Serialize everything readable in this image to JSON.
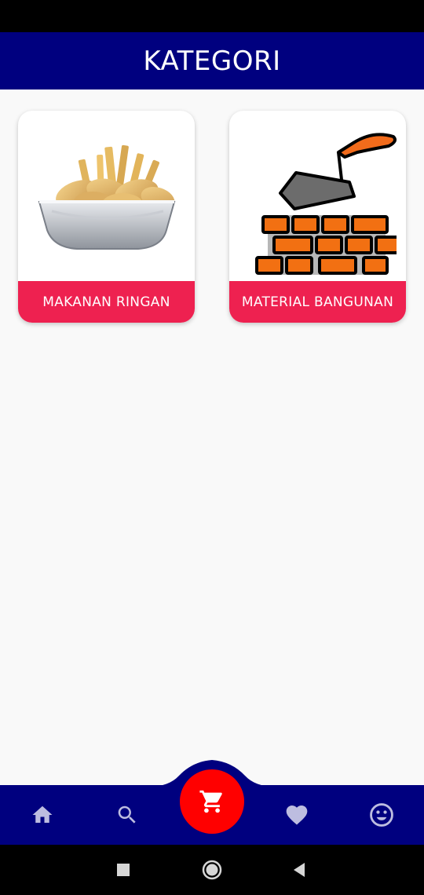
{
  "app_bar": {
    "title": "KATEGORI"
  },
  "categories": [
    {
      "label": "MAKANAN RINGAN",
      "icon": "snack-bowl-icon"
    },
    {
      "label": "MATERIAL BANGUNAN",
      "icon": "bricks-trowel-icon"
    }
  ],
  "bottom_nav": {
    "items": [
      {
        "icon": "home-icon"
      },
      {
        "icon": "search-icon"
      },
      {
        "icon": "cart-icon"
      },
      {
        "icon": "heart-icon"
      },
      {
        "icon": "smiley-icon"
      }
    ]
  },
  "colors": {
    "primary": "#00007f",
    "card_label": "#ee2150",
    "cart_button": "#ff0000",
    "nav_icon": "#bdbde0",
    "background": "#f9f9f9"
  }
}
